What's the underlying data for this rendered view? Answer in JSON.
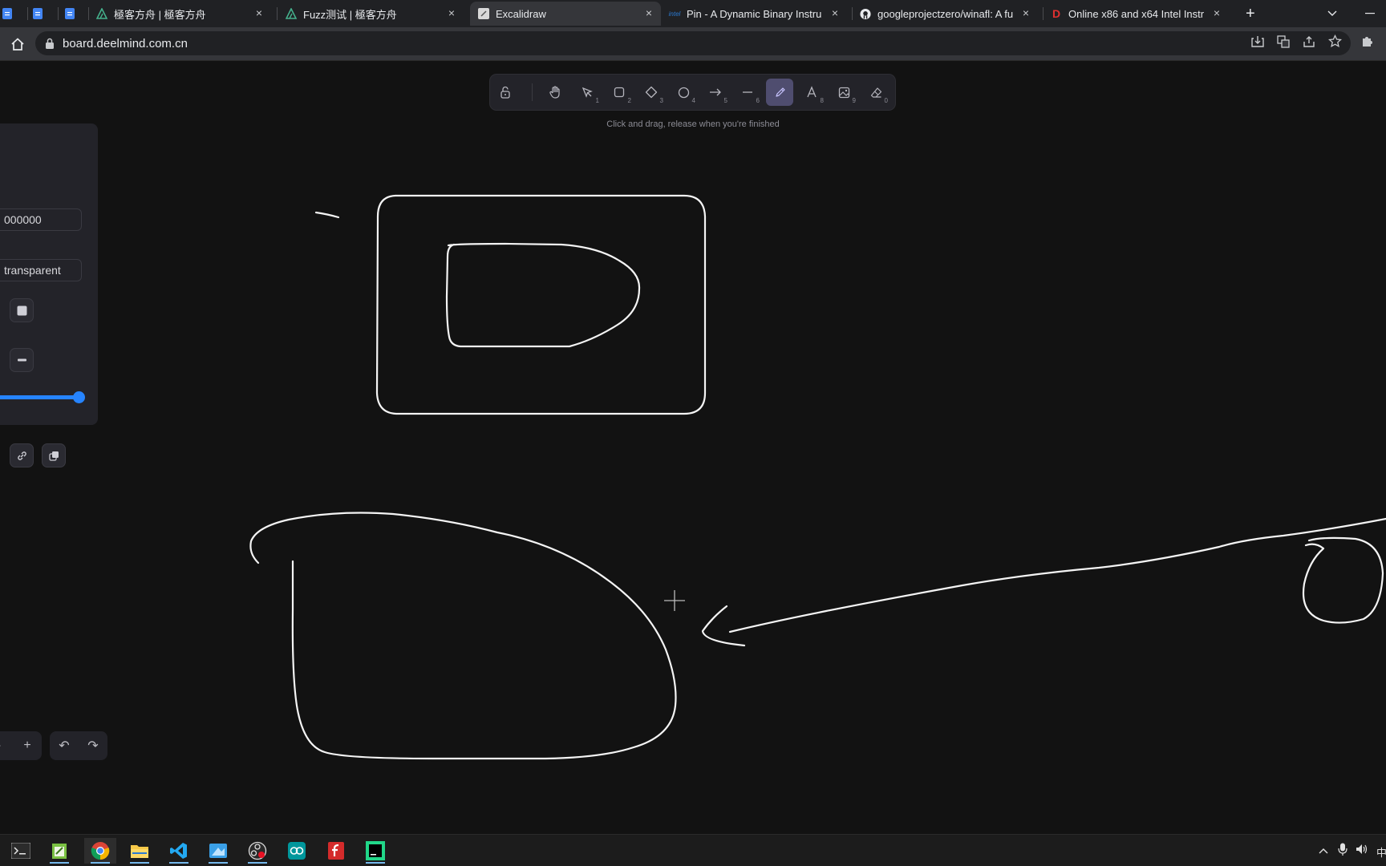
{
  "browser": {
    "tabs": [
      {
        "title": "",
        "favicon": "docs-icon"
      },
      {
        "title": "",
        "favicon": "docs-icon"
      },
      {
        "title": "",
        "favicon": "docs-icon"
      },
      {
        "title": "極客方舟 | 極客方舟",
        "favicon": "ark-icon"
      },
      {
        "title": "Fuzz测试 | 極客方舟",
        "favicon": "ark-icon"
      },
      {
        "title": "Excalidraw",
        "favicon": "excalidraw-icon",
        "active": true
      },
      {
        "title": "Pin - A Dynamic Binary Instru",
        "favicon": "intel-icon"
      },
      {
        "title": "googleprojectzero/winafl: A fu",
        "favicon": "github-icon"
      },
      {
        "title": "Online x86 and x64 Intel Instr",
        "favicon": "d-icon"
      }
    ],
    "intel_favicon_text": "intel",
    "d_favicon_text": "D",
    "new_tab_label": "+",
    "url": "board.deelmind.com.cn"
  },
  "toolbar": {
    "tools": [
      {
        "name": "lock",
        "key": ""
      },
      {
        "name": "hand",
        "key": ""
      },
      {
        "name": "selection",
        "key": "1"
      },
      {
        "name": "rectangle",
        "key": "2"
      },
      {
        "name": "diamond",
        "key": "3"
      },
      {
        "name": "ellipse",
        "key": "4"
      },
      {
        "name": "arrow",
        "key": "5"
      },
      {
        "name": "line",
        "key": "6"
      },
      {
        "name": "freedraw",
        "key": "",
        "active": true
      },
      {
        "name": "text",
        "key": "8"
      },
      {
        "name": "image",
        "key": "9"
      },
      {
        "name": "eraser",
        "key": "0"
      }
    ],
    "hint": "Click and drag, release when you're finished"
  },
  "properties": {
    "stroke_value": "000000",
    "background_value": "transparent",
    "opacity_percent": 100
  },
  "footer": {
    "zoom_in": "+",
    "undo": "↶",
    "redo": "↷"
  },
  "colors": {
    "accent": "#4f4d6f",
    "slider": "#2684ff",
    "canvas": "#121212",
    "stroke": "#ffffff"
  },
  "taskbar": {
    "apps": [
      "terminal-icon",
      "notepad-icon",
      "chrome-icon",
      "file-explorer-icon",
      "vscode-icon",
      "paint-icon",
      "obs-icon",
      "arduino-icon",
      "foxit-icon",
      "pycharm-icon"
    ],
    "ime_label": "中"
  }
}
